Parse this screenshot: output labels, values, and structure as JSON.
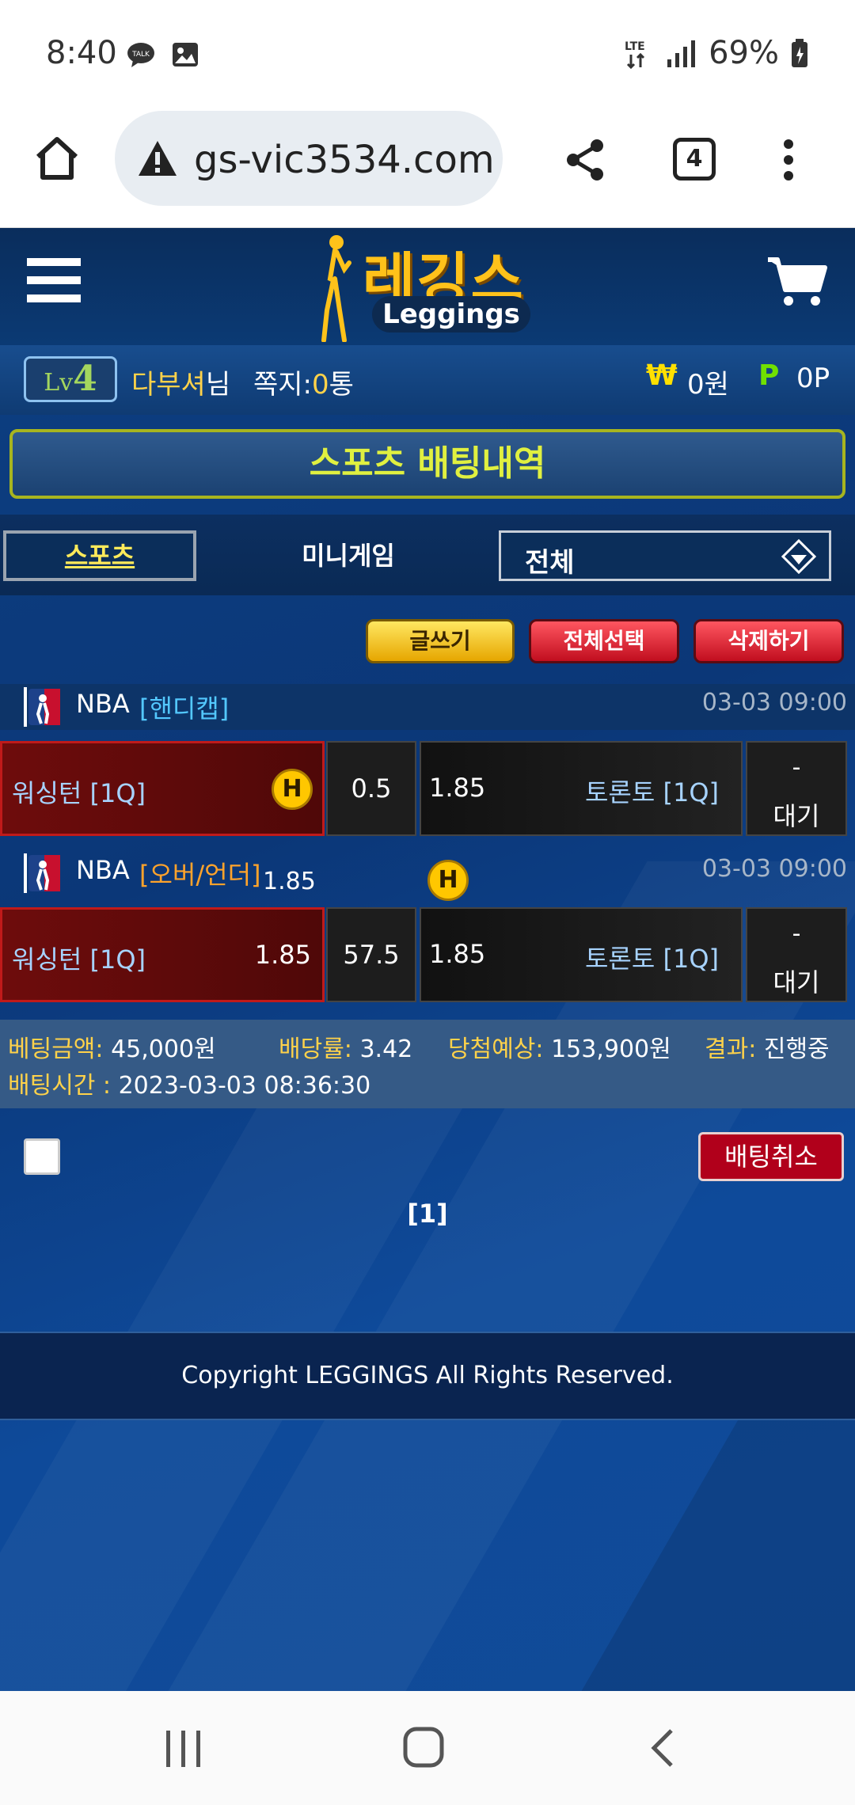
{
  "status_bar": {
    "time": "8:40",
    "network": "LTE",
    "battery": "69%",
    "icons": [
      "talk-icon",
      "gallery-icon",
      "signal-icon",
      "battery-icon"
    ]
  },
  "browser": {
    "url": "gs-vic3534.com",
    "tab_count": "4",
    "icons": [
      "home-icon",
      "warning-icon",
      "share-icon",
      "tabs-icon",
      "more-icon"
    ]
  },
  "site": {
    "logo_ko": "레깅스",
    "logo_en": "Leggings",
    "user": {
      "level_prefix": "Lv",
      "level": "4",
      "name": "다부셔",
      "name_suffix": "님",
      "msg_label": "쪽지:",
      "msg_count": "0",
      "msg_unit": "통",
      "won_symbol": "₩",
      "won_value": "0원",
      "point_symbol": "P",
      "point_value": "0P"
    },
    "page_title": "스포츠 배팅내역",
    "tabs": {
      "sports": "스포츠",
      "minigame": "미니게임"
    },
    "filter": {
      "selected": "전체"
    },
    "actions": {
      "write": "글쓰기",
      "select_all": "전체선택",
      "delete": "삭제하기"
    },
    "bets": [
      {
        "league": "NBA",
        "bet_type": "[핸디캡]",
        "bet_type_color": "#53c8ff",
        "datetime": "03-03 09:00",
        "home": "워싱턴 [1Q]",
        "home_odds": "",
        "line": "0.5",
        "away_odds": "1.85",
        "away": "토론토 [1Q]",
        "result_dash": "-",
        "result": "대기",
        "badge": "H"
      },
      {
        "league": "NBA",
        "bet_type": "[오버/언더]",
        "bet_type_color": "#ffa32b",
        "extra_odds": "1.85",
        "datetime": "03-03 09:00",
        "home": "워싱턴 [1Q]",
        "home_odds": "1.85",
        "line": "57.5",
        "away_odds": "1.85",
        "away": "토론토 [1Q]",
        "result_dash": "-",
        "result": "대기",
        "badge": "H"
      }
    ],
    "summary": {
      "amount_label": "베팅금액:",
      "amount": "45,000원",
      "odds_label": "배당률:",
      "odds": "3.42",
      "expected_label": "당첨예상:",
      "expected": "153,900원",
      "result_label": "결과:",
      "result": "진행중",
      "time_label": "배팅시간 :",
      "time": "2023-03-03 08:36:30"
    },
    "cancel_button": "배팅취소",
    "pagination": "[1]",
    "footer": "Copyright LEGGINGS All Rights Reserved."
  },
  "colors": {
    "accent_yellow": "#ffc21a",
    "site_blue": "#0b3778",
    "cancel_red": "#b1001b"
  }
}
